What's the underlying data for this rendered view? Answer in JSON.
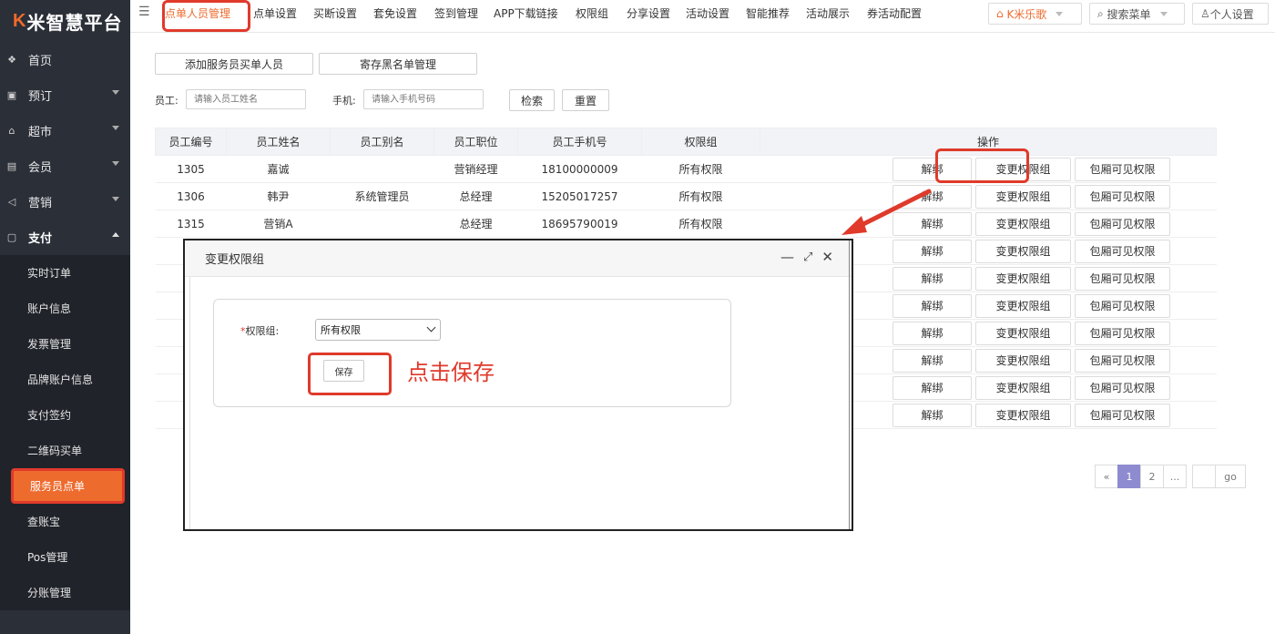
{
  "app": {
    "logo_k": "K",
    "logo_rest": "米智慧平台"
  },
  "sidebar": {
    "items": [
      {
        "label": "首页",
        "icon": "home-icon",
        "glyph": "❖",
        "has_children": false
      },
      {
        "label": "预订",
        "icon": "calendar-icon",
        "glyph": "▣",
        "has_children": true
      },
      {
        "label": "超市",
        "icon": "shop-icon",
        "glyph": "⌂",
        "has_children": true
      },
      {
        "label": "会员",
        "icon": "card-icon",
        "glyph": "▤",
        "has_children": true
      },
      {
        "label": "营销",
        "icon": "megaphone-icon",
        "glyph": "◁",
        "has_children": true
      },
      {
        "label": "支付",
        "icon": "wallet-icon",
        "glyph": "▢",
        "has_children": true,
        "open": true
      }
    ],
    "sub_items": [
      "实时订单",
      "账户信息",
      "发票管理",
      "品牌账户信息",
      "支付签约",
      "二维码买单",
      "服务员点单",
      "查账宝",
      "Pos管理",
      "分账管理"
    ],
    "active_sub": "服务员点单"
  },
  "topbar": {
    "tabs": [
      "点单人员管理",
      "点单设置",
      "买断设置",
      "套免设置",
      "签到管理",
      "APP下载链接",
      "权限组",
      "分享设置",
      "活动设置",
      "智能推荐",
      "活动展示",
      "券活动配置"
    ],
    "active_tab": "点单人员管理",
    "store": "K米乐歌",
    "search": "搜索菜单",
    "settings": "个人设置"
  },
  "toolbar": {
    "add_button": "添加服务员买单人员",
    "blacklist_button": "寄存黑名单管理"
  },
  "filters": {
    "staff_label": "员工:",
    "staff_placeholder": "请输入员工姓名",
    "phone_label": "手机:",
    "phone_placeholder": "请输入手机号码",
    "search_button": "检索",
    "reset_button": "重置"
  },
  "table": {
    "headers": [
      "员工编号",
      "员工姓名",
      "员工别名",
      "员工职位",
      "员工手机号",
      "权限组",
      "操作"
    ],
    "rows": [
      [
        "1305",
        "嘉诚",
        "",
        "营销经理",
        "18100000009",
        "所有权限"
      ],
      [
        "1306",
        "韩尹",
        "系统管理员",
        "总经理",
        "15205017257",
        "所有权限"
      ],
      [
        "1315",
        "营销A",
        "",
        "总经理",
        "18695790019",
        "所有权限"
      ]
    ],
    "hidden_rows": 7,
    "actions": [
      "解绑",
      "变更权限组",
      "包厢可见权限"
    ]
  },
  "pagination": {
    "prev": "«",
    "pages": [
      "1",
      "2",
      "..."
    ],
    "current": "1",
    "go": "go"
  },
  "modal": {
    "title": "变更权限组",
    "field_label": "权限组:",
    "field_required": "*",
    "field_value": "所有权限",
    "save_button": "保存",
    "hint": "点击保存"
  },
  "colors": {
    "accent": "#ee6b2e",
    "highlight": "#e03a2b",
    "sidebar": "#2b2f38",
    "pager_active": "#8f8bd0"
  }
}
